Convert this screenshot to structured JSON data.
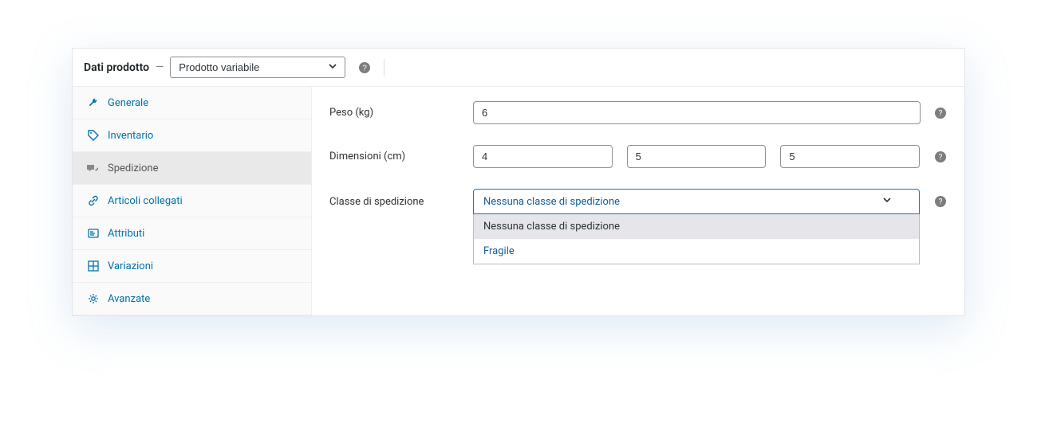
{
  "header": {
    "label": "Dati prodotto",
    "dash": "—",
    "type_options_selected": "Prodotto variabile"
  },
  "tabs": [
    {
      "id": "general",
      "label": "Generale",
      "icon": "wrench"
    },
    {
      "id": "inventory",
      "label": "Inventario",
      "icon": "tag"
    },
    {
      "id": "shipping",
      "label": "Spedizione",
      "icon": "truck",
      "active": true
    },
    {
      "id": "linked",
      "label": "Articoli collegati",
      "icon": "link"
    },
    {
      "id": "attributes",
      "label": "Attributi",
      "icon": "list"
    },
    {
      "id": "variations",
      "label": "Variazioni",
      "icon": "grid"
    },
    {
      "id": "advanced",
      "label": "Avanzate",
      "icon": "gear"
    }
  ],
  "fields": {
    "weight_label": "Peso (kg)",
    "weight_value": "6",
    "dimensions_label": "Dimensioni (cm)",
    "dim_length": "4",
    "dim_width": "5",
    "dim_height": "5",
    "shipping_class_label": "Classe di spedizione",
    "shipping_class_selected": "Nessuna classe di spedizione",
    "shipping_class_options": [
      "Nessuna classe di spedizione",
      "Fragile"
    ]
  }
}
